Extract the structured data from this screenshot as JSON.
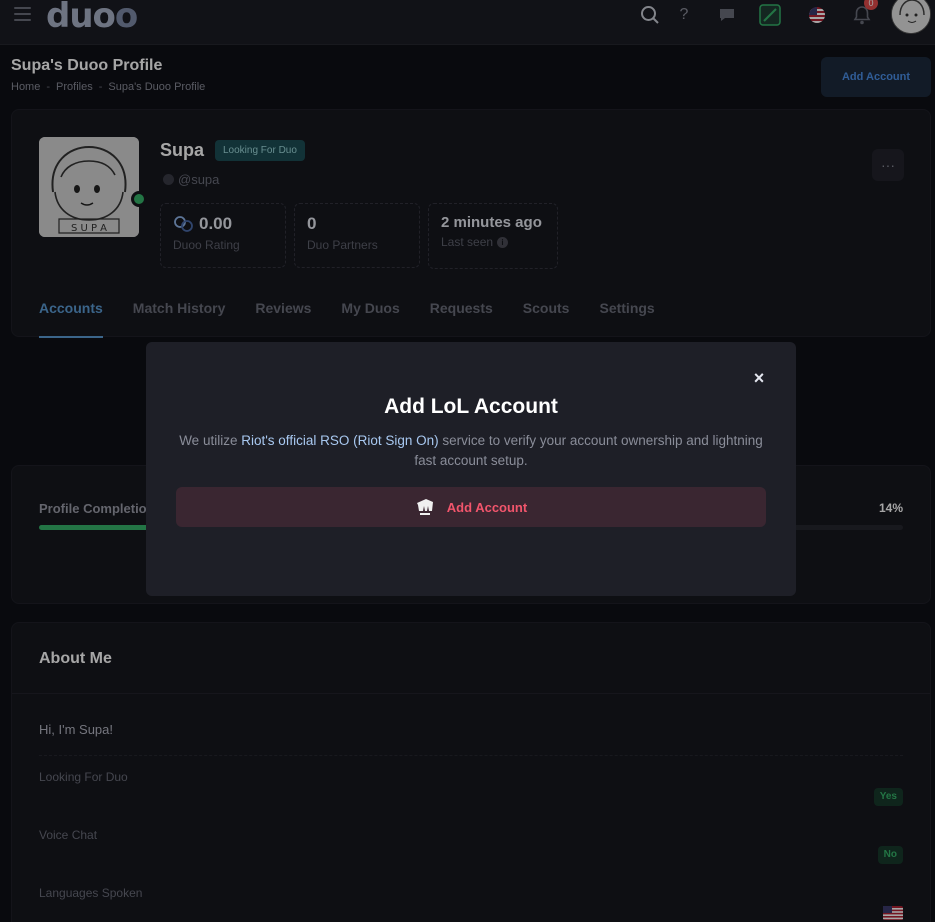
{
  "header": {
    "logo": "duo",
    "logo_suffix": "o",
    "help_glyph": "?",
    "notification_count": "0"
  },
  "page": {
    "title": "Supa's Duoo Profile",
    "breadcrumb": [
      "Home",
      "Profiles",
      "Supa's Duoo Profile"
    ],
    "add_account_button": "Add Account"
  },
  "profile": {
    "name": "Supa",
    "status_badge": "Looking For Duo",
    "handle": "@supa",
    "more_glyph": "···",
    "stats": [
      {
        "value": "0.00",
        "label": "Duoo Rating"
      },
      {
        "value": "0",
        "label": "Duo Partners"
      },
      {
        "value": "2 minutes ago",
        "label": "Last seen"
      }
    ],
    "tabs": [
      "Accounts",
      "Match History",
      "Reviews",
      "My Duos",
      "Requests",
      "Scouts",
      "Settings"
    ],
    "active_tab": "Accounts"
  },
  "completion": {
    "label": "Profile Completion",
    "percent_text": "14%",
    "percent": 14
  },
  "about": {
    "title": "About Me",
    "bio": "Hi, I'm Supa!",
    "fields": [
      {
        "label": "Looking For Duo",
        "value": "Yes"
      },
      {
        "label": "Voice Chat",
        "value": "No"
      },
      {
        "label": "Languages Spoken",
        "value": ""
      }
    ]
  },
  "modal": {
    "title": "Add LoL Account",
    "desc_before": "We utilize ",
    "desc_link": "Riot's official RSO (Riot Sign On)",
    "desc_after": " service to verify your account ownership and lightning fast account setup.",
    "button": "Add Account",
    "close_glyph": "×"
  },
  "colors": {
    "accent": "#5b9bd5",
    "success": "#37b46a",
    "danger": "#f1556c",
    "background": "#0f1016"
  },
  "icons": [
    "hamburger-icon",
    "search-icon",
    "help-icon",
    "chat-icon",
    "app-icon",
    "us-flag-icon",
    "bell-icon",
    "riot-fist-icon",
    "close-icon",
    "info-icon",
    "duoo-rating-icon"
  ]
}
